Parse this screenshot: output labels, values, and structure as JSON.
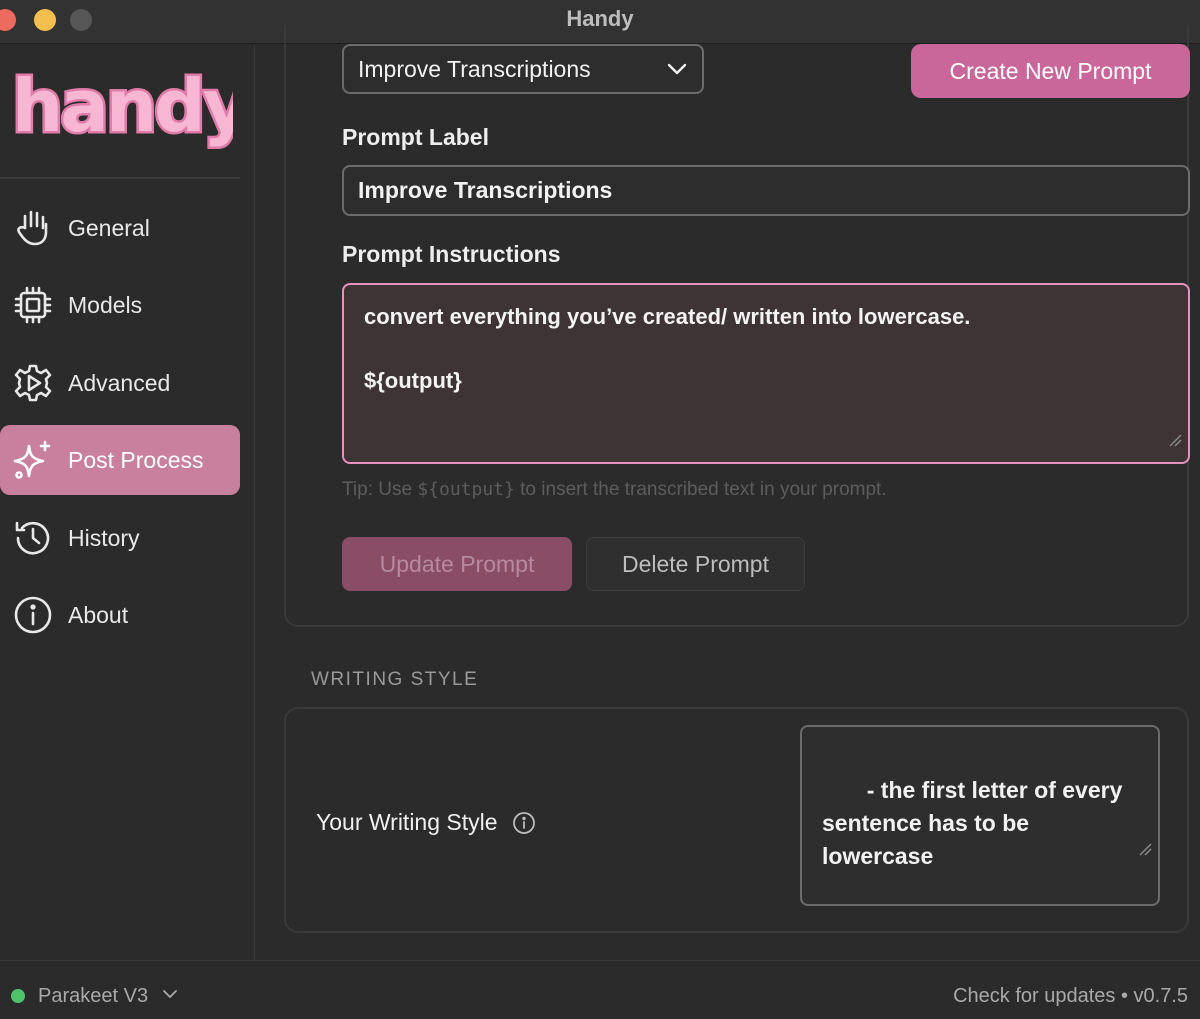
{
  "window": {
    "title": "Handy"
  },
  "sidebar": {
    "logo_text": "handy",
    "items": [
      {
        "label": "General",
        "icon": "hand-icon",
        "active": false
      },
      {
        "label": "Models",
        "icon": "cpu-icon",
        "active": false
      },
      {
        "label": "Advanced",
        "icon": "gear-icon",
        "active": false
      },
      {
        "label": "Post Process",
        "icon": "sparkle-icon",
        "active": true
      },
      {
        "label": "History",
        "icon": "history-icon",
        "active": false
      },
      {
        "label": "About",
        "icon": "info-icon",
        "active": false
      }
    ]
  },
  "prompt_editor": {
    "selected_prompt": "Improve Transcriptions",
    "create_button": "Create New Prompt",
    "label_heading": "Prompt Label",
    "label_value": "Improve Transcriptions",
    "instructions_heading": "Prompt Instructions",
    "instructions_line1": "convert everything you’ve created/ written into lowercase.",
    "instructions_line2": "${output}",
    "tip_prefix": "Tip: Use ",
    "tip_code": "${output}",
    "tip_suffix": " to insert the transcribed text in your prompt.",
    "update_button": "Update Prompt",
    "delete_button": "Delete Prompt"
  },
  "writing_style": {
    "section_title": "WRITING STYLE",
    "label": "Your Writing Style",
    "value": " - the first letter of every\nsentence has to be\nlowercase"
  },
  "footer": {
    "model": "Parakeet V3",
    "status_color": "#4fc36a",
    "right_text": "Check for updates • v0.7.5"
  },
  "colors": {
    "accent": "#c9679a",
    "active_nav": "#c9809c",
    "background": "#2b2b2b"
  }
}
